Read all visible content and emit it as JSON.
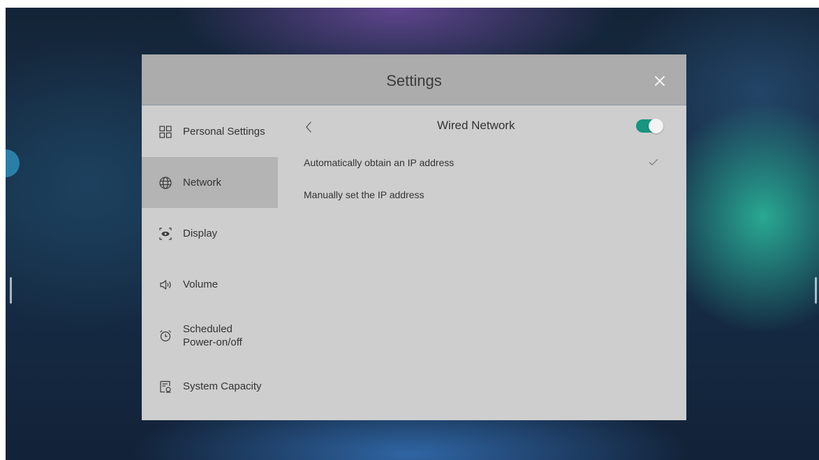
{
  "window": {
    "title": "Settings",
    "close_icon": "close-icon"
  },
  "sidebar": {
    "items": [
      {
        "label": "Personal Settings",
        "icon": "grid-icon",
        "active": false
      },
      {
        "label": "Network",
        "icon": "globe-icon",
        "active": true
      },
      {
        "label": "Display",
        "icon": "eye-icon",
        "active": false
      },
      {
        "label": "Volume",
        "icon": "speaker-icon",
        "active": false
      },
      {
        "label": "Scheduled\nPower-on/off",
        "icon": "alarm-clock-icon",
        "active": false
      },
      {
        "label": "System Capacity",
        "icon": "storage-icon",
        "active": false
      }
    ]
  },
  "panel": {
    "title": "Wired Network",
    "back_icon": "chevron-left-icon",
    "toggle_on": true,
    "toggle_color": "#17957e",
    "options": [
      {
        "label": "Automatically obtain an IP address",
        "selected": true
      },
      {
        "label": "Manually set the IP address",
        "selected": false
      }
    ]
  }
}
